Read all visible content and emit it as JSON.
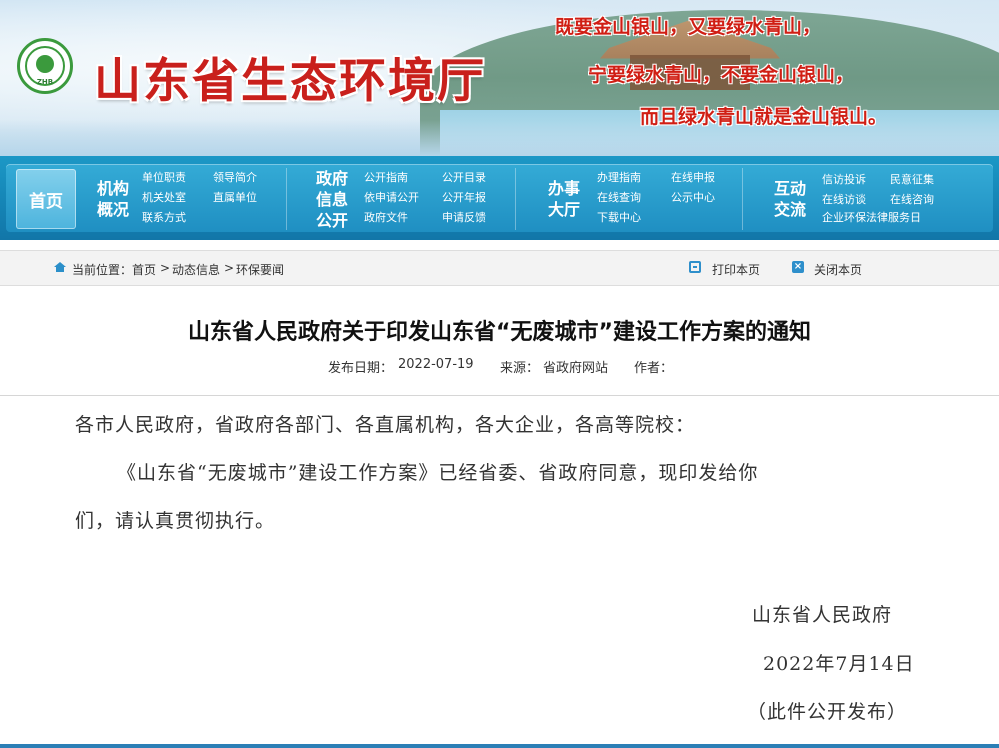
{
  "site": {
    "logo_text": "ZHB",
    "title": "山东省生态环境厅",
    "slogans": [
      "既要金山银山，又要绿水青山，",
      "宁要绿水青山，不要金山银山，",
      "而且绿水青山就是金山银山。"
    ]
  },
  "nav": {
    "home": "首页",
    "groups": [
      {
        "title_lines": [
          "机构",
          "概况"
        ],
        "links": [
          "单位职责",
          "领导简介",
          "机关处室",
          "直属单位",
          "联系方式"
        ]
      },
      {
        "title_lines": [
          "政府",
          "信息",
          "公开"
        ],
        "links": [
          "公开指南",
          "公开目录",
          "依申请公开",
          "公开年报",
          "政府文件",
          "申请反馈"
        ]
      },
      {
        "title_lines": [
          "办事",
          "大厅"
        ],
        "links": [
          "办理指南",
          "在线申报",
          "在线查询",
          "公示中心",
          "下载中心"
        ]
      },
      {
        "title_lines": [
          "互动",
          "交流"
        ],
        "links": [
          "信访投诉",
          "民意征集",
          "在线访谈",
          "在线咨询",
          "企业环保法律服务日"
        ]
      }
    ]
  },
  "breadcrumb": {
    "prefix": "当前位置：",
    "items": [
      "首页",
      "动态信息",
      "环保要闻"
    ],
    "separator": ">"
  },
  "tools": {
    "print": "打印本页",
    "close": "关闭本页"
  },
  "article": {
    "title": "山东省人民政府关于印发山东省“无废城市”建设工作方案的通知",
    "date_label": "发布日期：",
    "date": "2022-07-19",
    "source_label": "来源：",
    "source": "省政府网站",
    "author_label": "作者："
  },
  "body": {
    "salutation": "各市人民政府，省政府各部门、各直属机构，各大企业，各高等院校：",
    "para_line1": "《山东省“无废城市”建设工作方案》已经省委、省政府同意，现印发给你",
    "para_line2": "们，请认真贯彻执行。",
    "signature": "山东省人民政府",
    "sign_date": "2022年7月14日",
    "note": "（此件公开发布）"
  },
  "colors": {
    "nav_blue": "#1c98c6",
    "title_red": "#c9201c",
    "logo_green": "#3b9a3d"
  }
}
